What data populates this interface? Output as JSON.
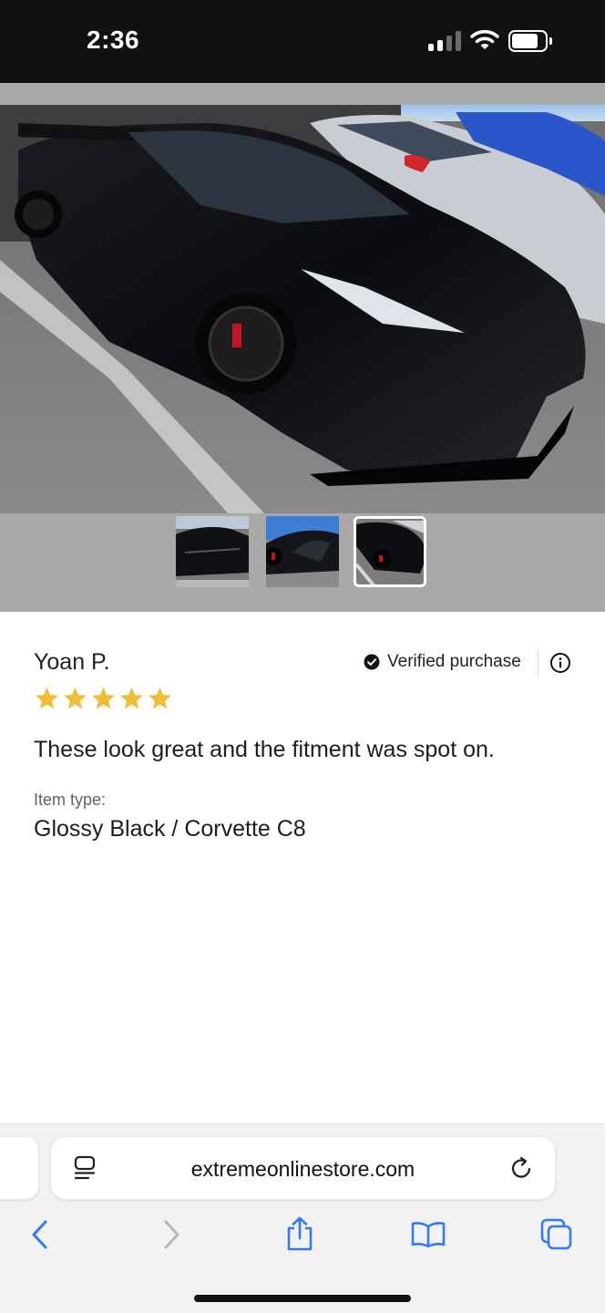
{
  "status_bar": {
    "time": "2:36"
  },
  "gallery": {
    "thumbnail_count": 3,
    "selected_thumbnail": 3
  },
  "review": {
    "reviewer_name": "Yoan P.",
    "verified_label": "Verified purchase",
    "rating": 5,
    "rating_max": 5,
    "text": "These look great and the fitment was spot on.",
    "item_type_label": "Item type:",
    "item_type_value": "Glossy Black / Corvette C8"
  },
  "browser": {
    "url": "extremeonlinestore.com"
  },
  "colors": {
    "status_bar_bg": "#111111",
    "gallery_bg": "#a9a9a9",
    "star": "#f1be3c",
    "ios_blue": "#3478f6",
    "disabled": "#b8b8b8",
    "toolbar_bg": "#f2f2f2"
  },
  "icons": {
    "verified": "check-circle-icon",
    "info": "info-icon",
    "page_settings": "page-settings-icon",
    "reload": "reload-icon",
    "back": "chevron-left-icon",
    "forward": "chevron-right-icon",
    "share": "share-icon",
    "bookmarks": "book-icon",
    "tabs": "tabs-icon"
  }
}
